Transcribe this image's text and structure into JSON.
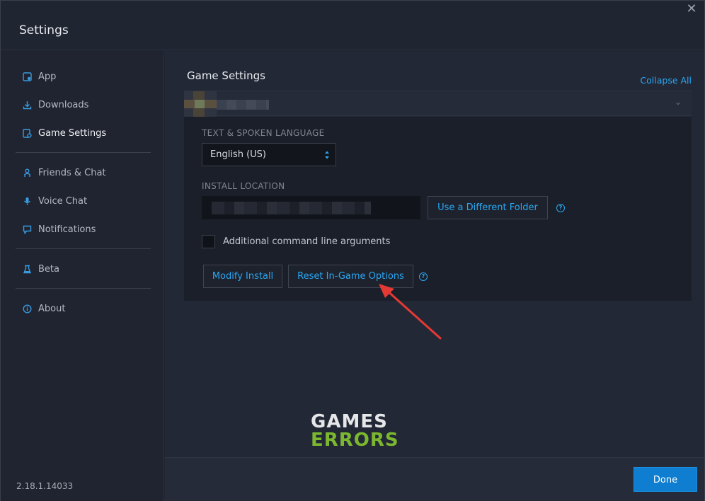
{
  "window": {
    "title": "Settings",
    "close_glyph": "✕"
  },
  "sidebar": {
    "items": [
      {
        "label": "App",
        "icon": "app-icon"
      },
      {
        "label": "Downloads",
        "icon": "download-icon"
      },
      {
        "label": "Game Settings",
        "icon": "game-settings-icon",
        "active": true
      },
      {
        "label": "Friends & Chat",
        "icon": "friends-icon"
      },
      {
        "label": "Voice Chat",
        "icon": "microphone-icon"
      },
      {
        "label": "Notifications",
        "icon": "notification-icon"
      },
      {
        "label": "Beta",
        "icon": "flask-icon"
      },
      {
        "label": "About",
        "icon": "info-icon"
      }
    ],
    "version": "2.18.1.14033"
  },
  "main": {
    "section_title": "Game Settings",
    "collapse_all": "Collapse All",
    "language": {
      "label": "TEXT & SPOKEN LANGUAGE",
      "value": "English (US)"
    },
    "install": {
      "label": "INSTALL LOCATION",
      "button": "Use a Different Folder"
    },
    "args_label": "Additional command line arguments",
    "modify_button": "Modify Install",
    "reset_button": "Reset In-Game Options",
    "help_glyph": "?"
  },
  "footer": {
    "done": "Done"
  },
  "watermark": {
    "line1": "GAMES",
    "line2": "ERRORS"
  },
  "colors": {
    "accent": "#2ba7f2",
    "done_bg": "#0f7ed0",
    "arrow": "#e53935",
    "logo_green": "#7cb82f"
  }
}
